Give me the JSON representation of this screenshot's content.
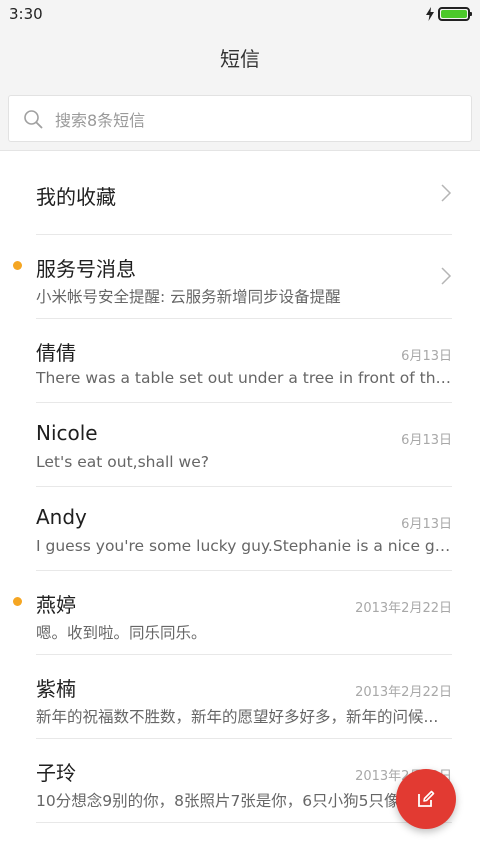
{
  "status_bar": {
    "time": "3:30",
    "battery_color": "#4bc82a"
  },
  "header": {
    "title": "短信"
  },
  "search": {
    "placeholder": "搜索8条短信"
  },
  "favorites": {
    "label": "我的收藏"
  },
  "service": {
    "name": "服务号消息",
    "preview": "小米帐号安全提醒: 云服务新增同步设备提醒",
    "unread": true
  },
  "threads": [
    {
      "name": "倩倩",
      "preview": "There was a table set out under a tree in front of the ho...",
      "date": "6月13日",
      "unread": false
    },
    {
      "name": "Nicole",
      "preview": "Let's eat out,shall we?",
      "date": "6月13日",
      "unread": false
    },
    {
      "name": "Andy",
      "preview": "I guess you're some lucky guy.Stephanie is a nice girl.",
      "date": "6月13日",
      "unread": false
    },
    {
      "name": "燕婷",
      "preview": "嗯。收到啦。同乐同乐。",
      "date": "2013年2月22日",
      "unread": true
    },
    {
      "name": "紫楠",
      "preview": "新年的祝福数不胜数，新年的愿望好多好多，新年的问候...",
      "date": "2013年2月22日",
      "unread": false
    },
    {
      "name": "子玲",
      "preview": "10分想念9别的你，8张照片7张是你，6只小狗5只像你",
      "date": "2013年2月22日",
      "unread": false
    }
  ],
  "colors": {
    "accent": "#e23a32",
    "unread_dot": "#f5a623"
  },
  "fab": {
    "icon": "compose-icon"
  }
}
